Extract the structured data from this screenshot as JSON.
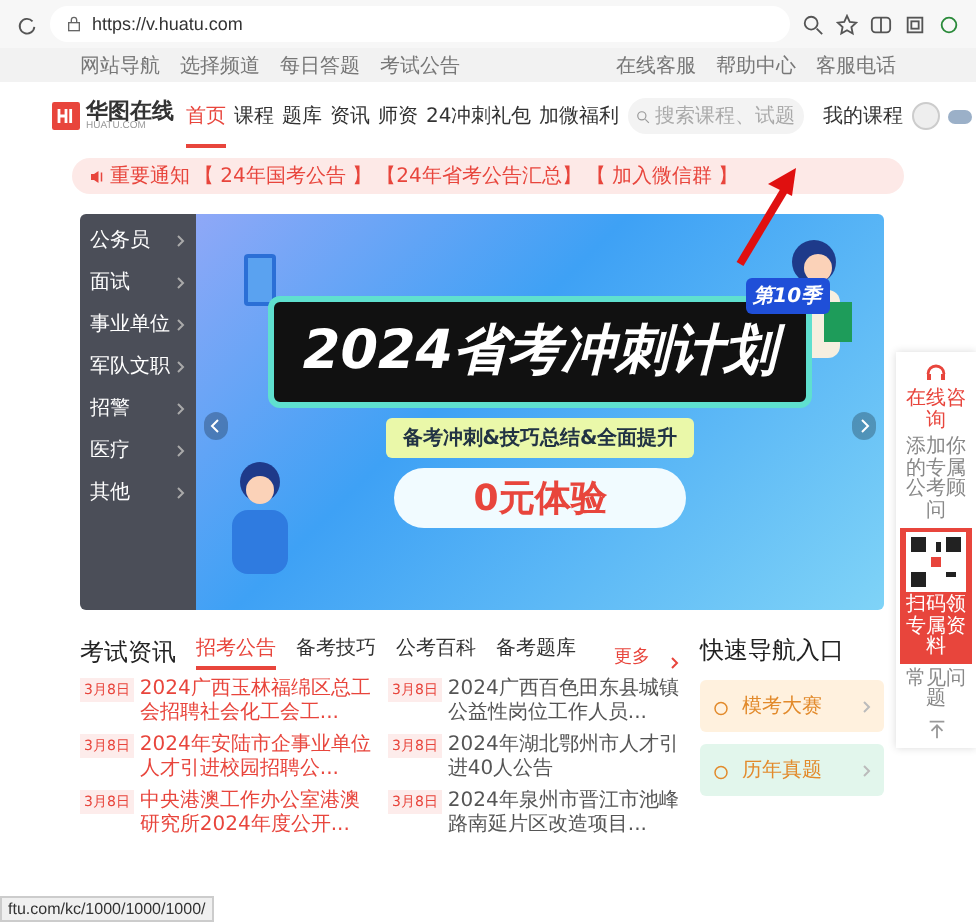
{
  "browser": {
    "url": "https://v.huatu.com"
  },
  "top_links": {
    "left": [
      "网站导航",
      "选择频道",
      "每日答题",
      "考试公告"
    ],
    "right": [
      "在线客服",
      "帮助中心",
      "客服电话"
    ]
  },
  "nav": {
    "logo_text": "华图在线",
    "logo_sub": "HUATU.COM",
    "items": [
      {
        "label": "首页",
        "selected": true
      },
      {
        "label": "课程",
        "selected": false
      },
      {
        "label": "题库",
        "selected": false
      },
      {
        "label": "资讯",
        "selected": false
      },
      {
        "label": "师资",
        "selected": false
      },
      {
        "label": "24冲刺礼包",
        "selected": false
      },
      {
        "label": "加微福利",
        "selected": false
      }
    ],
    "search": {
      "placeholder": "搜索课程、试题"
    },
    "my_courses": "我的课程"
  },
  "notice": {
    "label": "重要通知",
    "links": [
      "【 24年国考公告 】",
      "【24年省考公告汇总】",
      "【 加入微信群 】"
    ]
  },
  "sidebar": {
    "items": [
      "公务员",
      "面试",
      "事业单位",
      "军队文职",
      "招警",
      "医疗",
      "其他"
    ]
  },
  "banner": {
    "season": "第10季",
    "title": "2024省考冲刺计划",
    "subtitle": "备考冲刺&技巧总结&全面提升",
    "cta": "0元体验"
  },
  "widget": {
    "consult": "在线咨询",
    "advisor": "添加你的专属公考顾问",
    "qr_caption": "扫码领专属资料",
    "help": "常见问题"
  },
  "news": {
    "heading": "考试资讯",
    "tabs": [
      {
        "label": "招考公告",
        "selected": true
      },
      {
        "label": "备考技巧",
        "selected": false
      },
      {
        "label": "公考百科",
        "selected": false
      },
      {
        "label": "备考题库",
        "selected": false
      }
    ],
    "more": "更多",
    "columns": [
      [
        {
          "date": "3月8日",
          "title": "2024广西玉林福绵区总工会招聘社会化工会工..."
        },
        {
          "date": "3月8日",
          "title": "2024年安陆市企事业单位人才引进校园招聘公..."
        },
        {
          "date": "3月8日",
          "title": "中央港澳工作办公室港澳研究所2024年度公开..."
        }
      ],
      [
        {
          "date": "3月8日",
          "title": "2024广西百色田东县城镇公益性岗位工作人员..."
        },
        {
          "date": "3月8日",
          "title": "2024年湖北鄂州市人才引进40人公告"
        },
        {
          "date": "3月8日",
          "title": "2024年泉州市晋江市池峰路南延片区改造项目..."
        }
      ]
    ]
  },
  "quick_nav": {
    "title": "快速导航入口",
    "items": [
      {
        "label": "模考大赛",
        "color": "#fff1de"
      },
      {
        "label": "历年真题",
        "color": "#e2f6ec"
      }
    ]
  },
  "status_url": "ftu.com/kc/1000/1000/1000/"
}
